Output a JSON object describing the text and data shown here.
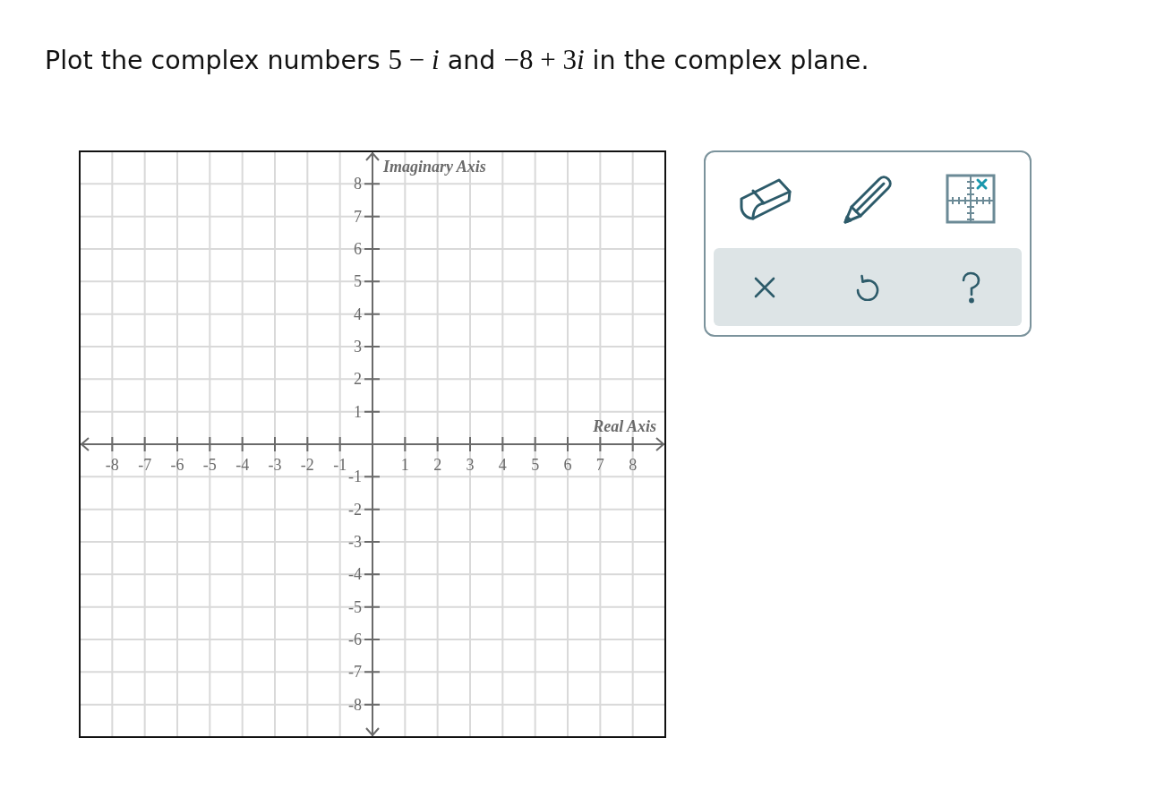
{
  "question": {
    "parts": [
      {
        "kind": "text",
        "text": "Plot the complex numbers "
      },
      {
        "kind": "math",
        "text": "5 − "
      },
      {
        "kind": "variable",
        "text": "i"
      },
      {
        "kind": "text",
        "text": " and "
      },
      {
        "kind": "math",
        "text": "−8 + 3"
      },
      {
        "kind": "variable",
        "text": "i"
      },
      {
        "kind": "text",
        "text": " in the complex plane."
      }
    ]
  },
  "graph": {
    "chart_data": [
      {
        "type": "scatter",
        "xlabel": "Real Axis",
        "ylabel": "Imaginary Axis",
        "xlim": [
          -9,
          9
        ],
        "ylim": [
          -9,
          9
        ],
        "xticks": [
          -8,
          -7,
          -6,
          -5,
          -4,
          -3,
          -2,
          -1,
          1,
          2,
          3,
          4,
          5,
          6,
          7,
          8
        ],
        "yticks": [
          -8,
          -7,
          -6,
          -5,
          -4,
          -3,
          -2,
          -1,
          1,
          2,
          3,
          4,
          5,
          6,
          7,
          8
        ],
        "grid": true
      }
    ]
  }
}
